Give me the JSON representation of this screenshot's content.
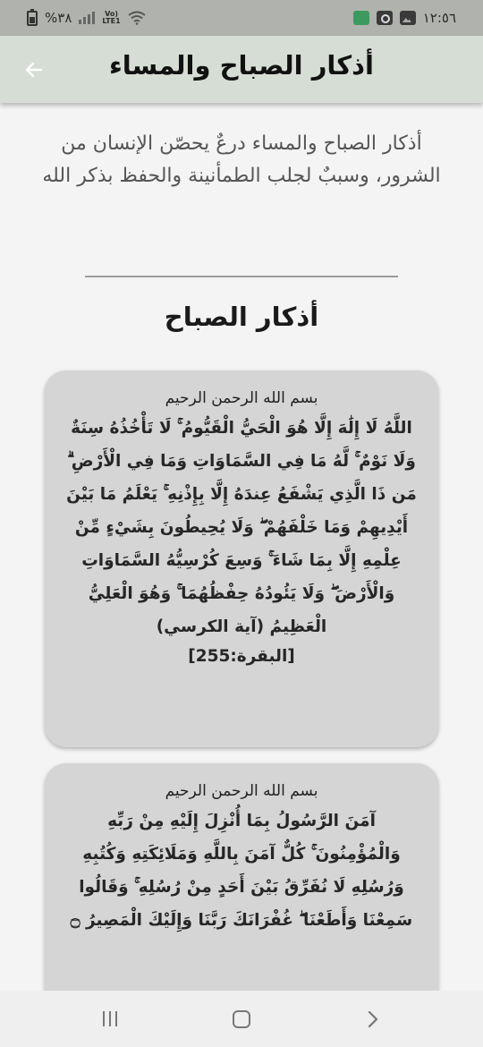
{
  "status_bar": {
    "battery_percent": "%٣٨",
    "network": "VoLTE1",
    "time": "١٢:٥٦",
    "icons": [
      "battery-icon",
      "signal-icon",
      "volte-icon",
      "wifi-icon",
      "quran-app-icon",
      "camera-icon",
      "gallery-icon"
    ]
  },
  "app_bar": {
    "title": "أذكار الصباح والمساء",
    "back_icon": "arrow-back-icon",
    "background": "#d6ddd4"
  },
  "intro_text": "أذكار الصباح والمساء درعٌ يحصّن الإنسان من الشرور، وسببٌ لجلب الطمأنينة والحفظ بذكر الله",
  "section_title": "أذكار الصباح",
  "cards": [
    {
      "basmala": "بسم الله الرحمن الرحيم",
      "text": "اللَّهُ لَا إِلَٰهَ إِلَّا هُوَ الْحَيُّ الْقَيُّومُ ۚ لَا تَأْخُذُهُ سِنَةٌ وَلَا نَوْمٌ ۚ لَّهُ مَا فِي السَّمَاوَاتِ وَمَا فِي الْأَرْضِ ۗ مَن ذَا الَّذِي يَشْفَعُ عِندَهُ إِلَّا بِإِذْنِهِ ۚ يَعْلَمُ مَا بَيْنَ أَيْدِيهِمْ وَمَا خَلْفَهُمْ ۖ وَلَا يُحِيطُونَ بِشَيْءٍ مِّنْ عِلْمِهِ إِلَّا بِمَا شَاءَ ۚ وَسِعَ كُرْسِيُّهُ السَّمَاوَاتِ وَالْأَرْضَ ۖ وَلَا يَئُودُهُ حِفْظُهُمَا ۚ وَهُوَ الْعَلِيُّ الْعَظِيمُ (آية الكرسي)",
      "reference": "[البقرة:255]"
    },
    {
      "basmala": "بسم الله الرحمن الرحيم",
      "text": "آمَنَ الرَّسُولُ بِمَا أُنْزِلَ إِلَيْهِ مِنْ رَبِّهِ وَالْمُؤْمِنُونَ ۚ كُلٌّ آمَنَ بِاللَّهِ وَمَلَائِكَتِهِ وَكُتُبِهِ وَرُسُلِهِ لَا نُفَرِّقُ بَيْنَ أَحَدٍ مِنْ رُسُلِهِ ۚ وَقَالُوا سَمِعْنَا وَأَطَعْنَا ۖ غُفْرَانَكَ رَبَّنَا وَإِلَيْكَ الْمَصِيرُ ۝"
    }
  ],
  "nav_bar": {
    "icons": [
      "recents-icon",
      "home-icon",
      "back-nav-icon"
    ]
  }
}
